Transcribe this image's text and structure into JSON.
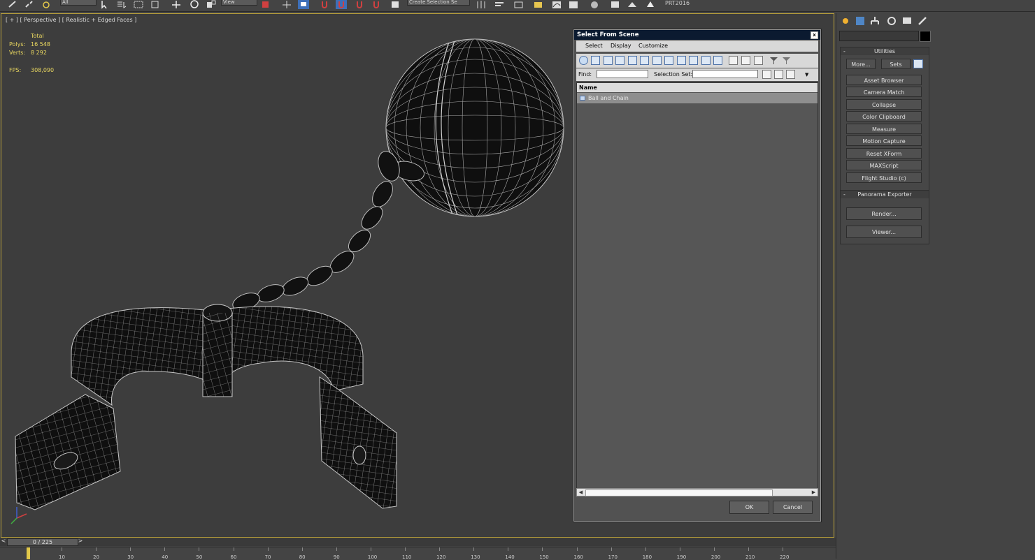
{
  "toolbar": {
    "selection_filter": "All",
    "view_combo": "View",
    "named_selection": "Create Selection Se",
    "app_label": "PRT2016",
    "icons": [
      "link-icon",
      "unlink-icon",
      "bind-icon",
      "select-icon",
      "select-by-name-icon",
      "rect-region-icon",
      "window-crossing-icon",
      "move-icon",
      "rotate-icon",
      "scale-icon",
      "snap-icon",
      "angle-snap-icon",
      "percent-snap-icon",
      "spinner-snap-icon",
      "edit-named-selection-icon",
      "mirror-icon",
      "align-icon",
      "layer-icon",
      "graphite-icon",
      "schematic-icon",
      "material-editor-icon",
      "render-setup-icon",
      "rendered-frame-icon",
      "render-icon"
    ]
  },
  "viewport": {
    "label": "[ + ] [ Perspective ] [ Realistic + Edged Faces ]",
    "stats": {
      "total_label": "Total",
      "polys_label": "Polys:",
      "polys_value": "16 548",
      "verts_label": "Verts:",
      "verts_value": "8 292",
      "fps_label": "FPS:",
      "fps_value": "308,090"
    }
  },
  "timeline": {
    "frame_display": "0 / 225",
    "prev_label": "<",
    "next_label": ">",
    "ticks": [
      "10",
      "20",
      "30",
      "40",
      "50",
      "60",
      "70",
      "80",
      "90",
      "100",
      "110",
      "120",
      "130",
      "140",
      "150",
      "160",
      "170",
      "180",
      "190",
      "200",
      "210",
      "220"
    ]
  },
  "dialog": {
    "title": "Select From Scene",
    "close_label": "x",
    "menu": [
      "Select",
      "Display",
      "Customize"
    ],
    "find_label": "Find:",
    "find_value": "",
    "selection_set_label": "Selection Set:",
    "selection_set_value": "",
    "column_header": "Name",
    "rows": [
      {
        "label": "Ball and Chain"
      }
    ],
    "ok_label": "OK",
    "cancel_label": "Cancel"
  },
  "command_panel": {
    "utilities": {
      "title": "Utilities",
      "more_label": "More...",
      "sets_label": "Sets",
      "buttons": [
        "Asset Browser",
        "Camera Match",
        "Collapse",
        "Color Clipboard",
        "Measure",
        "Motion Capture",
        "Reset XForm",
        "MAXScript",
        "Flight Studio (c)"
      ]
    },
    "panorama": {
      "title": "Panorama Exporter",
      "buttons": [
        "Render...",
        "Viewer..."
      ]
    }
  },
  "colors": {
    "viewport_border": "#b89f3a",
    "stats_text": "#e9d760",
    "dialog_title_bg": "#0b1a30",
    "wire": "#d6d6d6"
  }
}
